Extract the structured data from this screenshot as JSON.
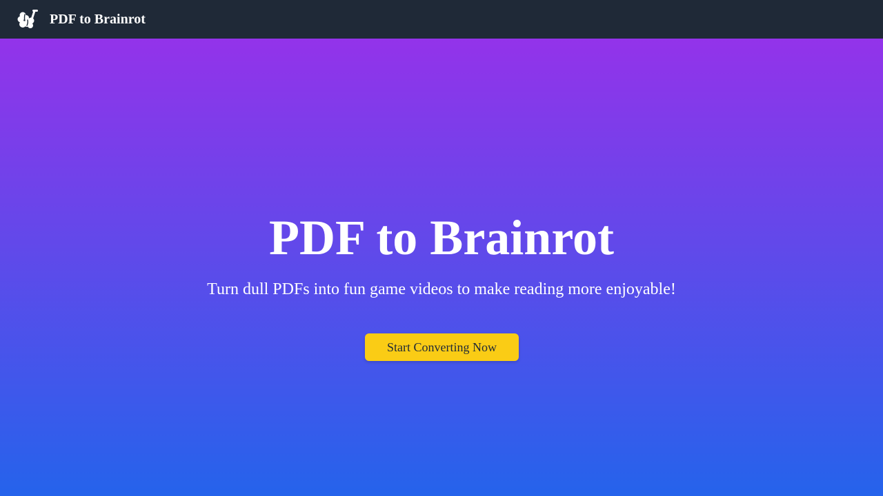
{
  "header": {
    "logo_icon": "brain-icon",
    "brand": "PDF to Brainrot"
  },
  "hero": {
    "title": "PDF to Brainrot",
    "subtitle": "Turn dull PDFs into fun game videos to make reading more enjoyable!",
    "cta_label": "Start Converting Now"
  },
  "colors": {
    "navbar": "#1f2937",
    "gradient_top": "#9333ea",
    "gradient_bottom": "#2563eb",
    "cta_bg": "#facc15",
    "cta_text": "#1f2937",
    "text": "#ffffff"
  }
}
